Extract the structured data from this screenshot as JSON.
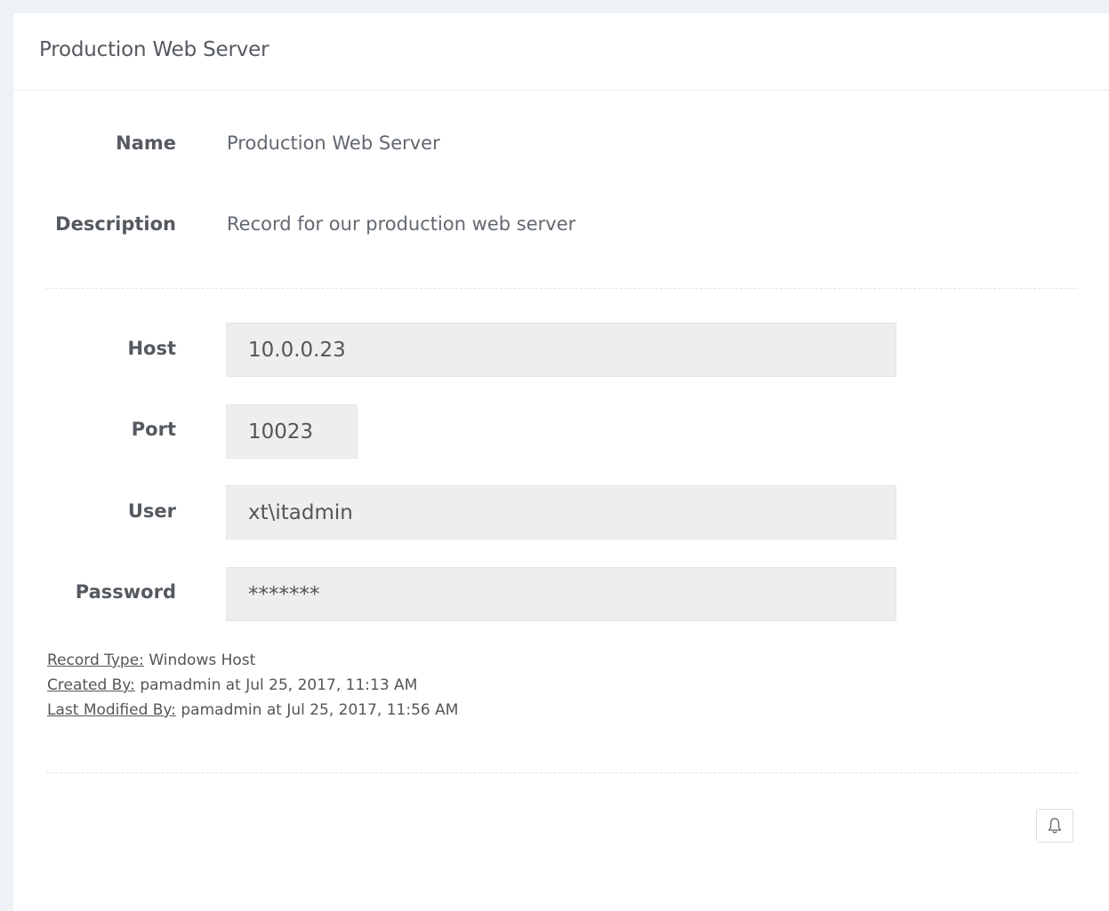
{
  "panel": {
    "title": "Production Web Server"
  },
  "record": {
    "name_label": "Name",
    "name_value": "Production Web Server",
    "description_label": "Description",
    "description_value": "Record for our production web server"
  },
  "fields": {
    "host_label": "Host",
    "host_value": "10.0.0.23",
    "port_label": "Port",
    "port_value": "10023",
    "user_label": "User",
    "user_value": "xt\\itadmin",
    "password_label": "Password",
    "password_value": "*******"
  },
  "meta": {
    "record_type_key": "Record Type:",
    "record_type_value": "Windows Host",
    "created_by_key": "Created By:",
    "created_by_value": "pamadmin at Jul 25, 2017, 11:13 AM",
    "modified_by_key": "Last Modified By:",
    "modified_by_value": "pamadmin at Jul 25, 2017, 11:56 AM"
  },
  "actions": {
    "bell_icon": "bell-icon"
  },
  "colors": {
    "page_background": "#eef1f5",
    "panel_background": "#ffffff",
    "input_background": "#eeeeee",
    "text": "#555555"
  }
}
